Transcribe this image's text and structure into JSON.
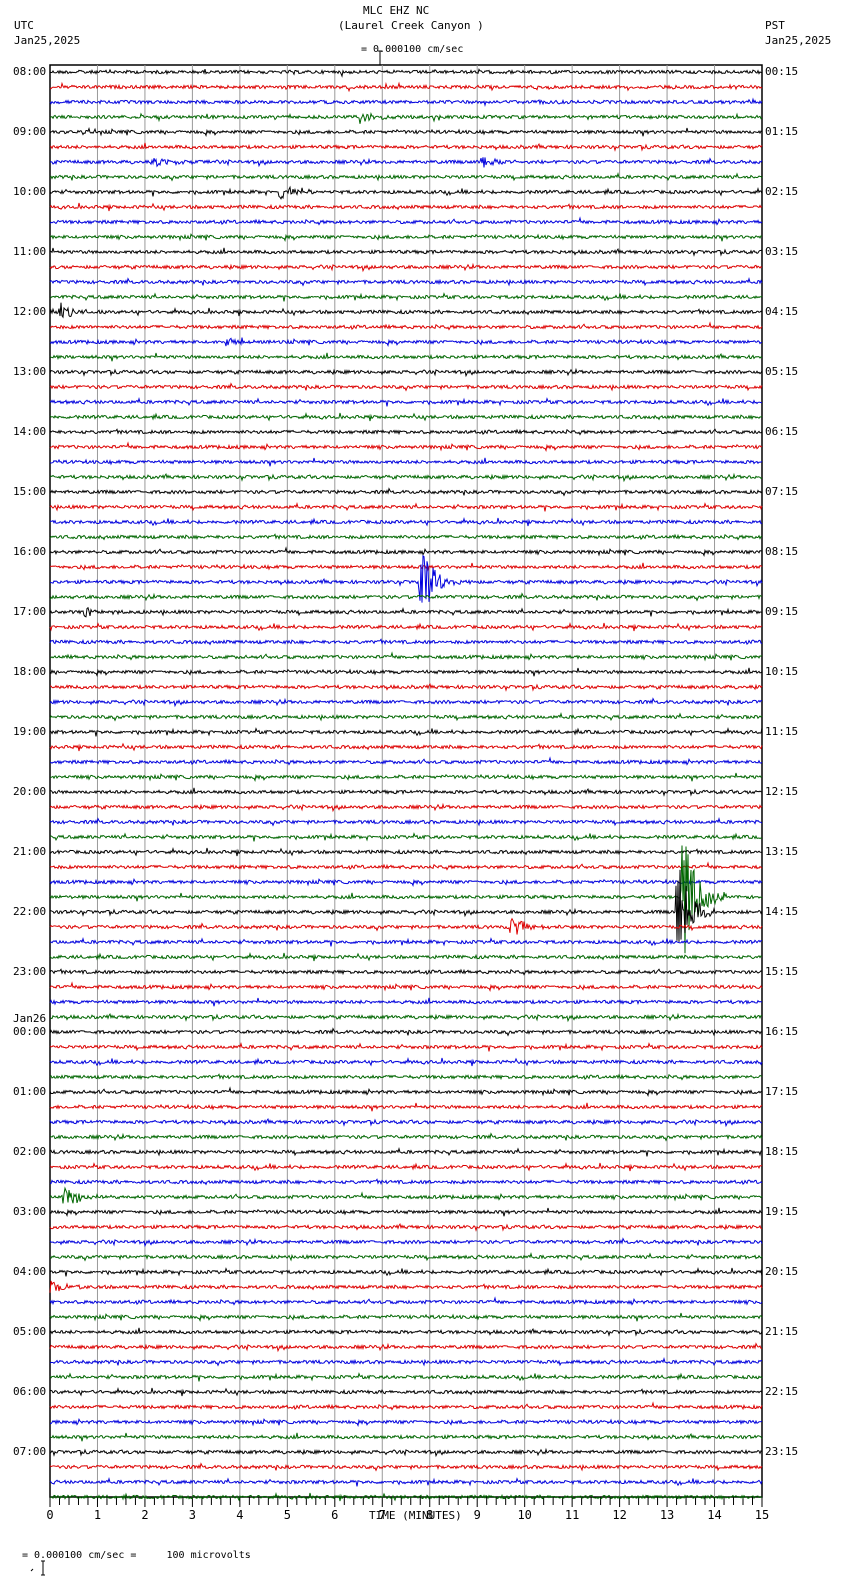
{
  "header": {
    "title": "MLC EHZ NC",
    "subtitle": "(Laurel Creek Canyon )",
    "left_tz": "UTC",
    "left_date": "Jan25,2025",
    "right_tz": "PST",
    "right_date": "Jan25,2025",
    "scale_text": "= 0.000100 cm/sec"
  },
  "footer": {
    "scale_text": "= 0.000100 cm/sec =     100 microvolts"
  },
  "chart_data": {
    "type": "line",
    "title": "MLC EHZ NC (Laurel Creek Canyon )",
    "xlabel": "TIME (MINUTES)",
    "xlim": [
      0,
      15
    ],
    "x_ticks": [
      "0",
      "1",
      "2",
      "3",
      "4",
      "5",
      "6",
      "7",
      "8",
      "9",
      "10",
      "11",
      "12",
      "13",
      "14",
      "15"
    ],
    "traces_per_hour": 4,
    "trace_colors": [
      "#000000",
      "#dd0000",
      "#0000dd",
      "#006600"
    ],
    "left_labels": [
      "08:00",
      "09:00",
      "10:00",
      "11:00",
      "12:00",
      "13:00",
      "14:00",
      "15:00",
      "16:00",
      "17:00",
      "18:00",
      "19:00",
      "20:00",
      "21:00",
      "22:00",
      "23:00",
      "00:00",
      "01:00",
      "02:00",
      "03:00",
      "04:00",
      "05:00",
      "06:00",
      "07:00"
    ],
    "day_change_label": "Jan26",
    "right_labels": [
      "00:15",
      "01:15",
      "02:15",
      "03:15",
      "04:15",
      "05:15",
      "06:15",
      "07:15",
      "08:15",
      "09:15",
      "10:15",
      "11:15",
      "12:15",
      "13:15",
      "14:15",
      "15:15",
      "16:15",
      "17:15",
      "18:15",
      "19:15",
      "20:15",
      "21:15",
      "22:15",
      "23:15"
    ],
    "events": [
      {
        "trace": 3,
        "minute": 6.6,
        "amplitude": 6
      },
      {
        "trace": 6,
        "minute": 2.3,
        "amplitude": 5
      },
      {
        "trace": 6,
        "minute": 9.2,
        "amplitude": 5
      },
      {
        "trace": 8,
        "minute": 4.95,
        "amplitude": 6
      },
      {
        "trace": 16,
        "minute": 0.3,
        "amplitude": 6
      },
      {
        "trace": 18,
        "minute": 3.8,
        "amplitude": 5
      },
      {
        "trace": 34,
        "minute": 7.9,
        "amplitude": 26
      },
      {
        "trace": 36,
        "minute": 0.8,
        "amplitude": 5
      },
      {
        "trace": 55,
        "minute": 13.4,
        "amplitude": 58
      },
      {
        "trace": 56,
        "minute": 13.3,
        "amplitude": 42
      },
      {
        "trace": 57,
        "minute": 9.8,
        "amplitude": 10
      },
      {
        "trace": 75,
        "minute": 0.4,
        "amplitude": 10
      },
      {
        "trace": 81,
        "minute": 0.05,
        "amplitude": 8
      }
    ]
  }
}
